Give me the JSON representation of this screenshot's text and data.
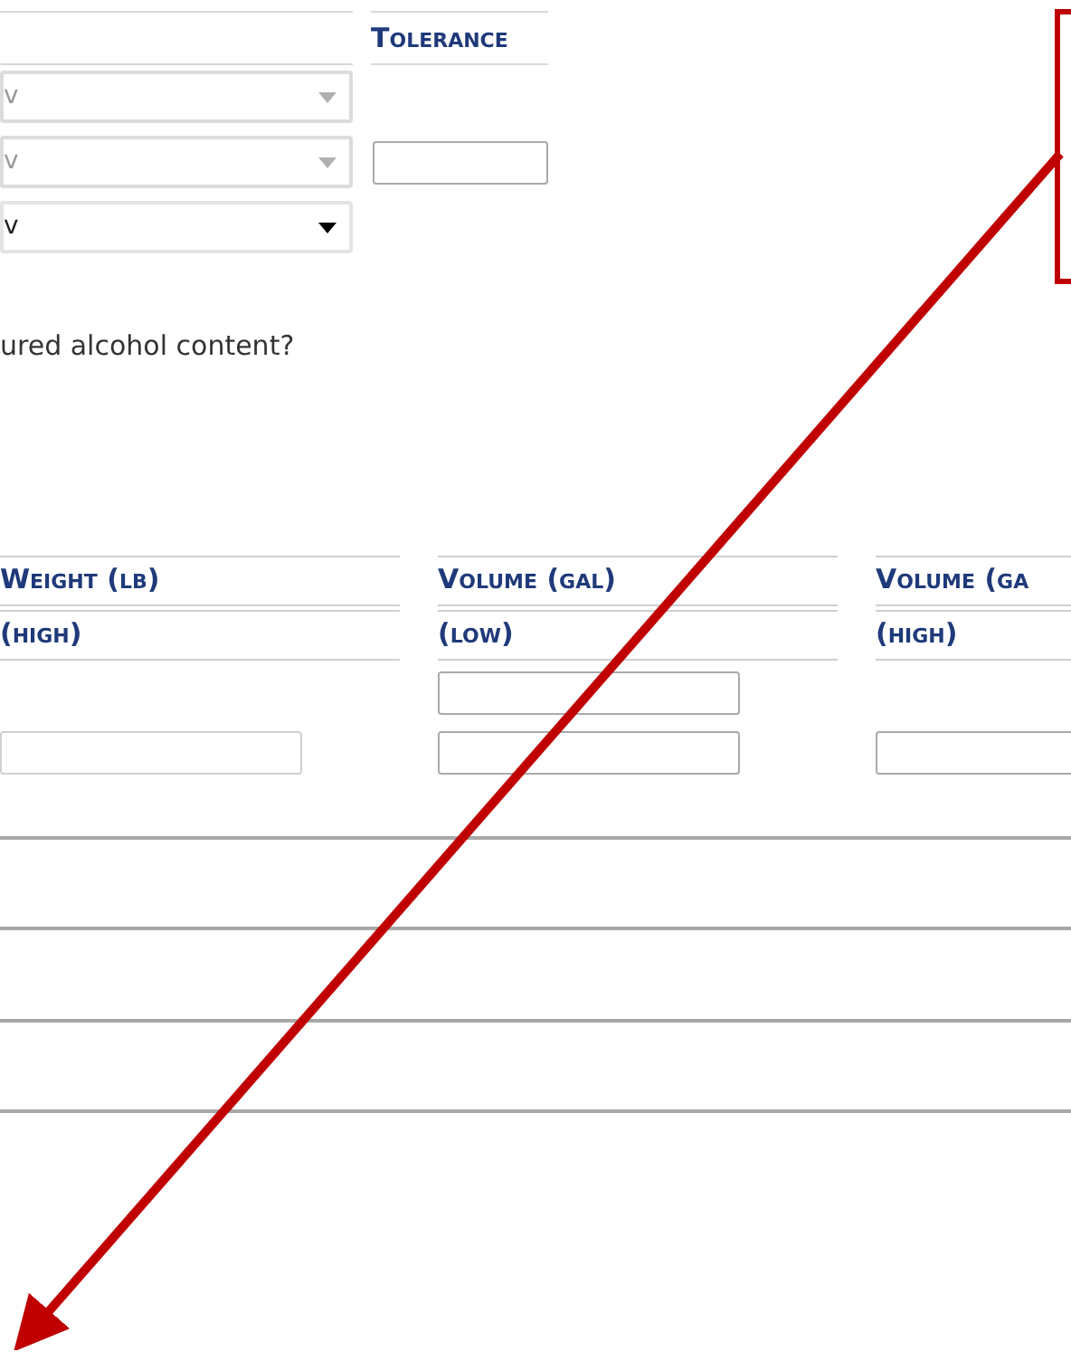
{
  "top_header": {
    "column_2": "Tolerance"
  },
  "selects": [
    {
      "value": "v",
      "disabled": true
    },
    {
      "value": "v",
      "disabled": true
    },
    {
      "value": "v",
      "disabled": false
    }
  ],
  "question": "ured alcohol content?",
  "columns": [
    {
      "title": "Weight (lb)",
      "subtitle": "(high)",
      "has_first_input": false
    },
    {
      "title": "Volume (gal)",
      "subtitle": "(low)",
      "has_first_input": true
    },
    {
      "title": "Volume (ga",
      "subtitle": "(high)",
      "has_first_input": false
    }
  ]
}
